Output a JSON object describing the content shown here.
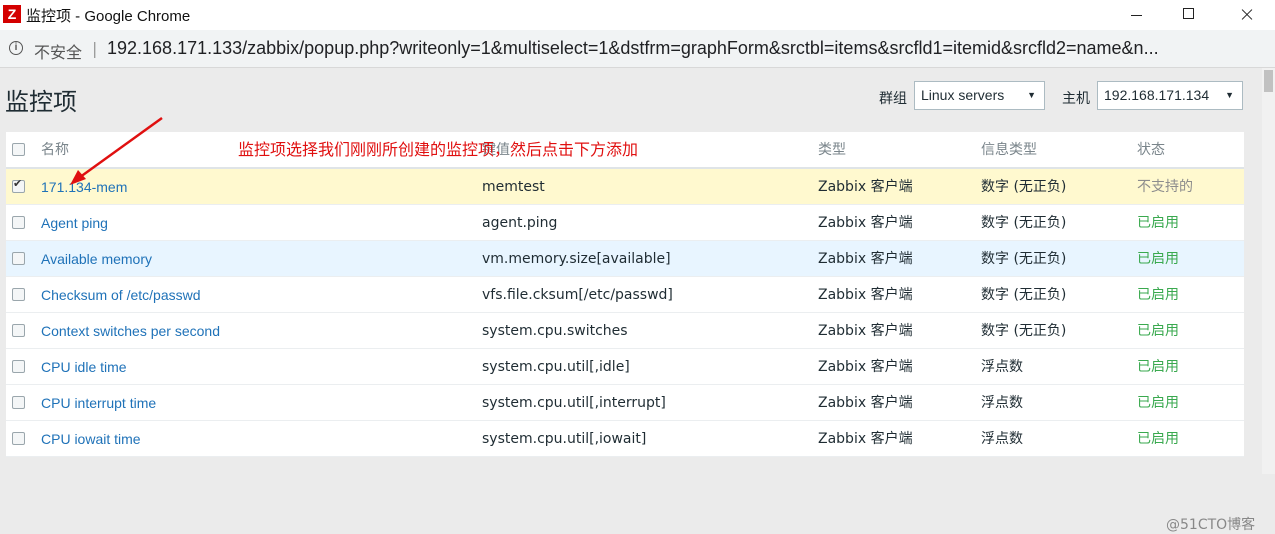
{
  "window": {
    "logo": "Z",
    "title": "监控项 - Google Chrome"
  },
  "address": {
    "security": "不安全",
    "separator": "|",
    "url": "192.168.171.133/zabbix/popup.php?writeonly=1&multiselect=1&dstfrm=graphForm&srctbl=items&srcfld1=itemid&srcfld2=name&n..."
  },
  "page": {
    "title": "监控项",
    "group_label": "群组",
    "group_value": "Linux servers",
    "host_label": "主机",
    "host_value": "192.168.171.134"
  },
  "annotation": "监控项选择我们刚刚所创建的监控项，然后点击下方添加",
  "watermark": "@51CTO博客",
  "table": {
    "headers": {
      "name": "名称",
      "key": "键值",
      "type": "类型",
      "info": "信息类型",
      "status": "状态"
    },
    "rows": [
      {
        "name": "171.134-mem",
        "key": "memtest",
        "type": "Zabbix 客户端",
        "info": "数字 (无正负)",
        "status": "不支持的",
        "checked": true
      },
      {
        "name": "Agent ping",
        "key": "agent.ping",
        "type": "Zabbix 客户端",
        "info": "数字 (无正负)",
        "status": "已启用",
        "checked": false
      },
      {
        "name": "Available memory",
        "key": "vm.memory.size[available]",
        "type": "Zabbix 客户端",
        "info": "数字 (无正负)",
        "status": "已启用",
        "checked": false
      },
      {
        "name": "Checksum of /etc/passwd",
        "key": "vfs.file.cksum[/etc/passwd]",
        "type": "Zabbix 客户端",
        "info": "数字 (无正负)",
        "status": "已启用",
        "checked": false
      },
      {
        "name": "Context switches per second",
        "key": "system.cpu.switches",
        "type": "Zabbix 客户端",
        "info": "数字 (无正负)",
        "status": "已启用",
        "checked": false
      },
      {
        "name": "CPU idle time",
        "key": "system.cpu.util[,idle]",
        "type": "Zabbix 客户端",
        "info": "浮点数",
        "status": "已启用",
        "checked": false
      },
      {
        "name": "CPU interrupt time",
        "key": "system.cpu.util[,interrupt]",
        "type": "Zabbix 客户端",
        "info": "浮点数",
        "status": "已启用",
        "checked": false
      },
      {
        "name": "CPU iowait time",
        "key": "system.cpu.util[,iowait]",
        "type": "Zabbix 客户端",
        "info": "浮点数",
        "status": "已启用",
        "checked": false
      }
    ]
  },
  "colors": {
    "annotation": "#e01010",
    "link": "#1f72b8",
    "enabled": "#3aa94f",
    "unsupported": "#8d8d8d",
    "selected_row": "#fff9cf"
  }
}
